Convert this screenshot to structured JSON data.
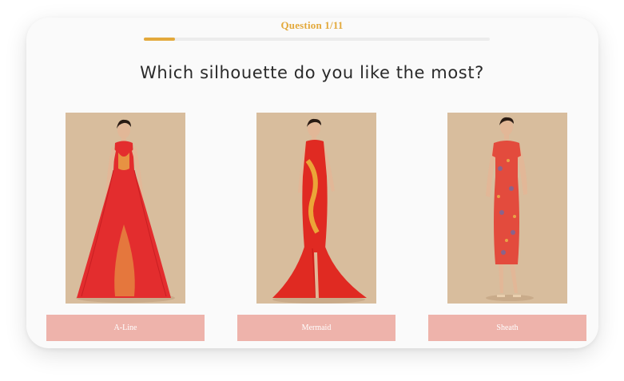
{
  "progress": {
    "label": "Question 1/11",
    "current": 1,
    "total": 11,
    "accent_color": "#e3a93b"
  },
  "question": {
    "text": "Which silhouette do you like the most?"
  },
  "options": [
    {
      "label": "A-Line",
      "image": "a-line-dress-photo",
      "dress_color": "#e32d2e"
    },
    {
      "label": "Mermaid",
      "image": "mermaid-dress-photo",
      "dress_color": "#e02a22"
    },
    {
      "label": "Sheath",
      "image": "sheath-dress-photo",
      "dress_color": "#e34b3d"
    }
  ],
  "colors": {
    "photo_background": "#d8bd9d",
    "button_background": "#eeb3ab",
    "button_text": "#ffffff"
  }
}
